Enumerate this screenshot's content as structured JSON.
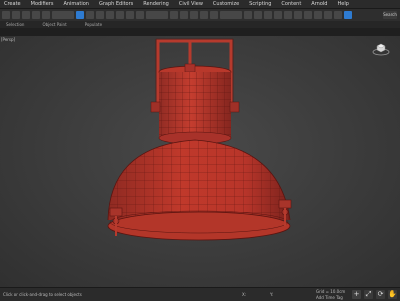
{
  "menu": {
    "items": [
      "Create",
      "Modifiers",
      "Animation",
      "Graph Editors",
      "Rendering",
      "Civil View",
      "Customize",
      "Scripting",
      "Content",
      "Arnold",
      "Help"
    ]
  },
  "search": {
    "label": "Search"
  },
  "ribbon": {
    "tabs": [
      "Selection",
      "Object Paint",
      "Populate"
    ]
  },
  "viewport": {
    "label": "[Persp]",
    "background_color": "#3e3e3e",
    "object": "industrial-pendant-lamp",
    "mesh_color": "#c0392b"
  },
  "status": {
    "message": "Click or click-and-drag to select objects",
    "x_label": "X:",
    "y_label": "Y:",
    "grid": "Grid = 10.0cm",
    "time_tag": "Add Time Tag"
  },
  "accent_color": "#2e7bd1"
}
